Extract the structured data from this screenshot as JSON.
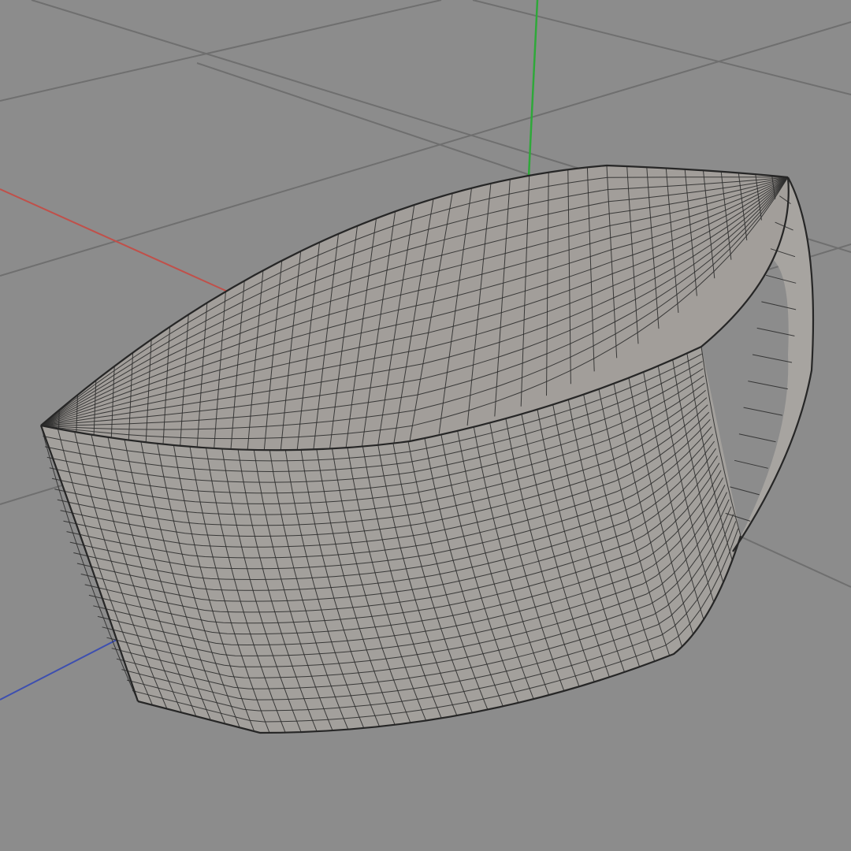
{
  "viewport": {
    "mode": "perspective",
    "display": "wireframe-shaded",
    "background_color": "#8c8c8c",
    "grid_color": "#6f6f6f",
    "grid_visible": true
  },
  "axes": {
    "x": {
      "name": "x-axis",
      "color": "#c0504a"
    },
    "y": {
      "name": "y-axis",
      "color": "#2fa83a"
    },
    "z": {
      "name": "z-axis",
      "color": "#3d4fb0"
    }
  },
  "object": {
    "shape": "half-disc",
    "wire_color": "#2e2e2e",
    "surface_color": "#a29e9a"
  }
}
